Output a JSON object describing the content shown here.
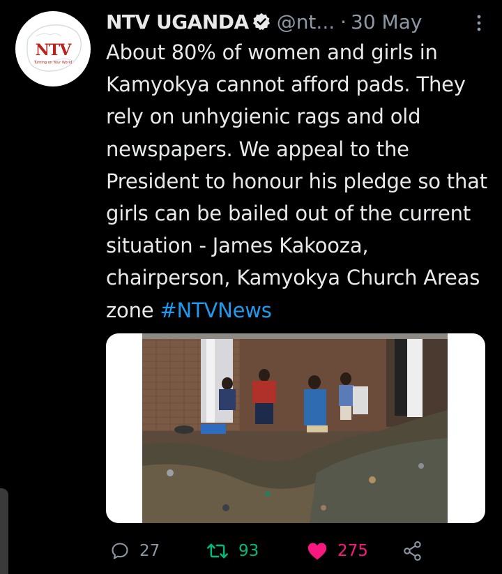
{
  "tweet": {
    "display_name": "NTV UGANDA",
    "handle": "@nt...",
    "separator": "·",
    "date": "30 May",
    "text": "About 80% of women and girls in Kamyokya cannot afford pads. They rely on unhygienic rags and old newspapers. We appeal to the President to honour his pledge so that girls can be bailed out of the current situation - James Kakooza, chairperson, Kamyokya Church Areas zone ",
    "hashtag": "#NTVNews",
    "avatar_logo": "NTV",
    "avatar_tagline": "Turning on Your World"
  },
  "actions": {
    "reply_count": "27",
    "retweet_count": "93",
    "like_count": "275"
  },
  "icons": {
    "verified": "verified-badge-icon",
    "more": "more-vertical-icon",
    "reply": "reply-bubble-icon",
    "retweet": "retweet-icon",
    "like": "heart-filled-icon",
    "share": "share-icon"
  },
  "colors": {
    "background": "#000000",
    "text": "#e7e9ea",
    "muted": "#8b98a5",
    "link": "#1d9bf0",
    "retweet": "#00ba7c",
    "like": "#f91880",
    "brand_red": "#b9241c"
  }
}
